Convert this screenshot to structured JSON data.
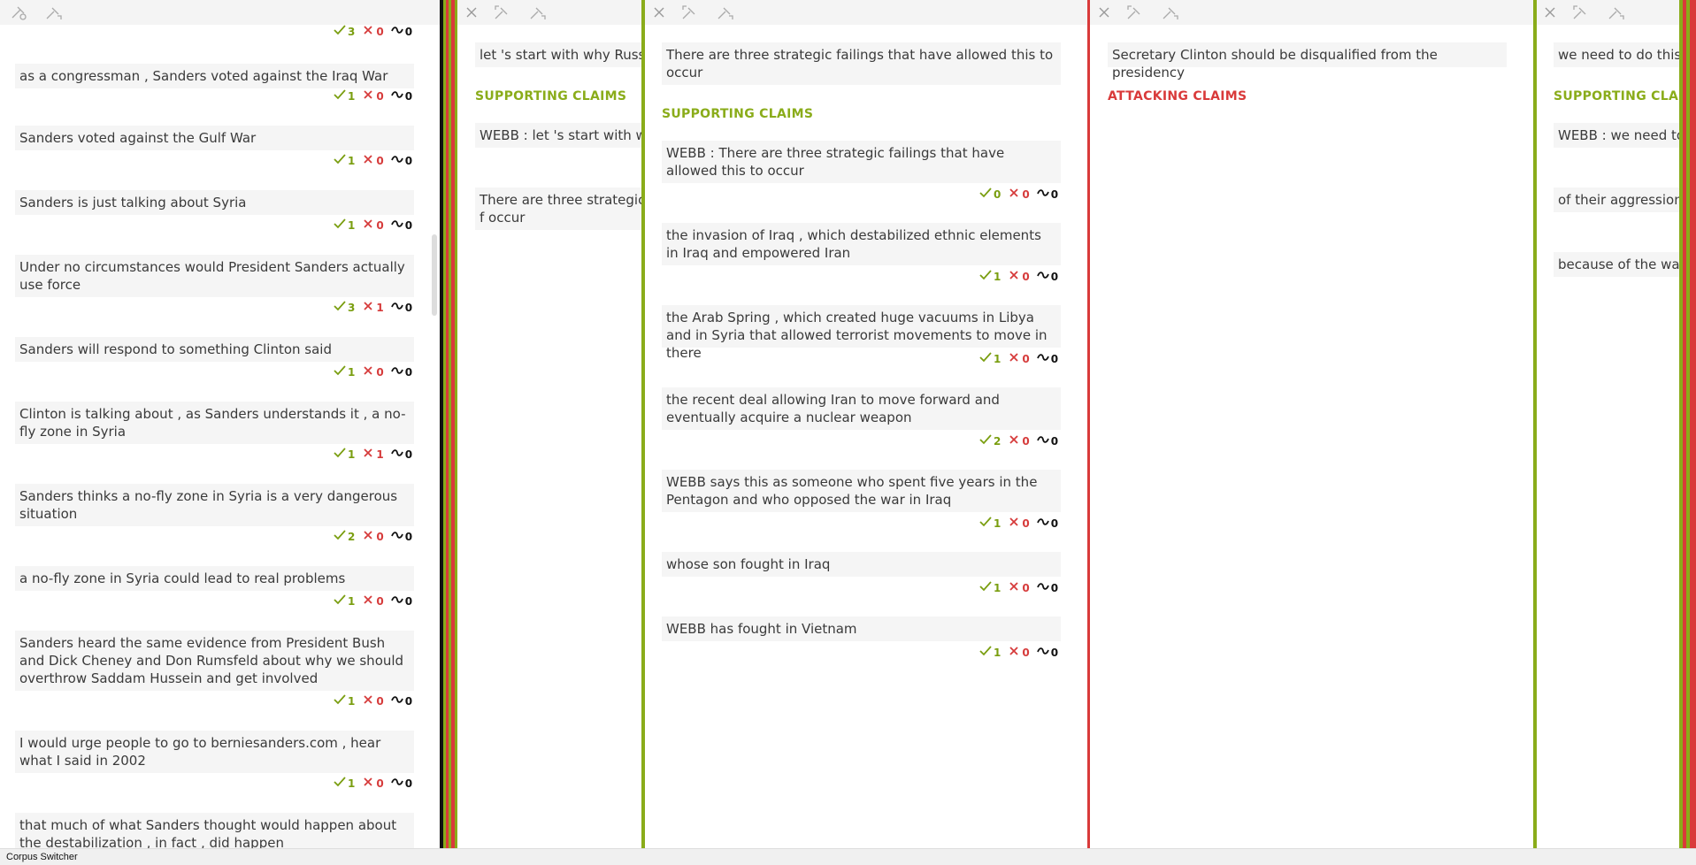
{
  "icons": {
    "unpin": "unpin-icon",
    "pin": "pin-icon",
    "close": "close-icon",
    "pin_left": "pin-left-icon",
    "pin_right": "pin-right-icon",
    "check": "check-icon",
    "cross": "cross-icon",
    "tilde": "tilde-icon"
  },
  "colors": {
    "support": "#8aac1a",
    "attack": "#d93a3a",
    "neutral": "#111111",
    "card_bg": "#f5f5f5",
    "toolbar_bg": "#f4f4f4"
  },
  "panel1": {
    "top_counts": {
      "yes": "3",
      "no": "0",
      "neutral": "0"
    },
    "claims": [
      {
        "text": "as a congressman , Sanders voted against the Iraq War",
        "yes": "1",
        "no": "0",
        "neutral": "0"
      },
      {
        "text": "Sanders voted against the Gulf War",
        "yes": "1",
        "no": "0",
        "neutral": "0"
      },
      {
        "text": "Sanders is just talking about Syria",
        "yes": "1",
        "no": "0",
        "neutral": "0"
      },
      {
        "text": "Under no circumstances would President Sanders actually use force",
        "yes": "3",
        "no": "1",
        "neutral": "0"
      },
      {
        "text": "Sanders will respond to something Clinton said",
        "yes": "1",
        "no": "0",
        "neutral": "0"
      },
      {
        "text": "Clinton is talking about , as Sanders understands it , a no-fly zone in Syria",
        "yes": "1",
        "no": "1",
        "neutral": "0"
      },
      {
        "text": "Sanders thinks a no-fly zone in Syria is a very dangerous situation",
        "yes": "2",
        "no": "0",
        "neutral": "0"
      },
      {
        "text": "a no-fly zone in Syria could lead to real problems",
        "yes": "1",
        "no": "0",
        "neutral": "0"
      },
      {
        "text": "Sanders heard the same evidence from President Bush and Dick Cheney and Don Rumsfeld about why we should overthrow Saddam Hussein and get involved",
        "yes": "1",
        "no": "0",
        "neutral": "0"
      },
      {
        "text": "I would urge people to go to berniesanders.com , hear what I said in 2002",
        "yes": "1",
        "no": "0",
        "neutral": "0"
      },
      {
        "text": "that much of what Sanders thought would happen about the destabilization , in fact , did happen"
      }
    ]
  },
  "panel2": {
    "main_claim": "let 's start with why Russia",
    "section_label": "SUPPORTING CLAIMS",
    "claims": [
      {
        "text": "WEBB : let 's start with wh"
      },
      {
        "text": "There are three strategic f occur"
      }
    ]
  },
  "panel3": {
    "main_claim": "There are three strategic failings that have allowed this to occur",
    "section_label": "SUPPORTING CLAIMS",
    "claims": [
      {
        "text": "WEBB : There are three strategic failings that have allowed this to occur",
        "yes": "0",
        "no": "0",
        "neutral": "0"
      },
      {
        "text": "the invasion of Iraq , which destabilized ethnic elements in Iraq and empowered Iran",
        "yes": "1",
        "no": "0",
        "neutral": "0"
      },
      {
        "text": "the Arab Spring , which created huge vacuums in Libya and in Syria that allowed terrorist movements to move in there",
        "yes": "1",
        "no": "0",
        "neutral": "0"
      },
      {
        "text": "the recent deal allowing Iran to move forward and eventually acquire a nuclear weapon",
        "yes": "2",
        "no": "0",
        "neutral": "0"
      },
      {
        "text": "WEBB says this as someone who spent five years in the Pentagon and who opposed the war in Iraq",
        "yes": "1",
        "no": "0",
        "neutral": "0"
      },
      {
        "text": "whose son fought in Iraq",
        "yes": "1",
        "no": "0",
        "neutral": "0"
      },
      {
        "text": "WEBB has fought in Vietnam",
        "yes": "1",
        "no": "0",
        "neutral": "0"
      }
    ]
  },
  "panel4": {
    "main_claim": "Secretary Clinton should be disqualified from the presidency",
    "section_label": "ATTACKING CLAIMS"
  },
  "panel5": {
    "main_claim": "we need to do this",
    "section_label": "SUPPORTING CLAIN",
    "claims": [
      {
        "text": "WEBB : we need to"
      },
      {
        "text": "of their aggression"
      },
      {
        "text": "because of the way"
      }
    ]
  },
  "footer": {
    "label": "Corpus Switcher"
  }
}
